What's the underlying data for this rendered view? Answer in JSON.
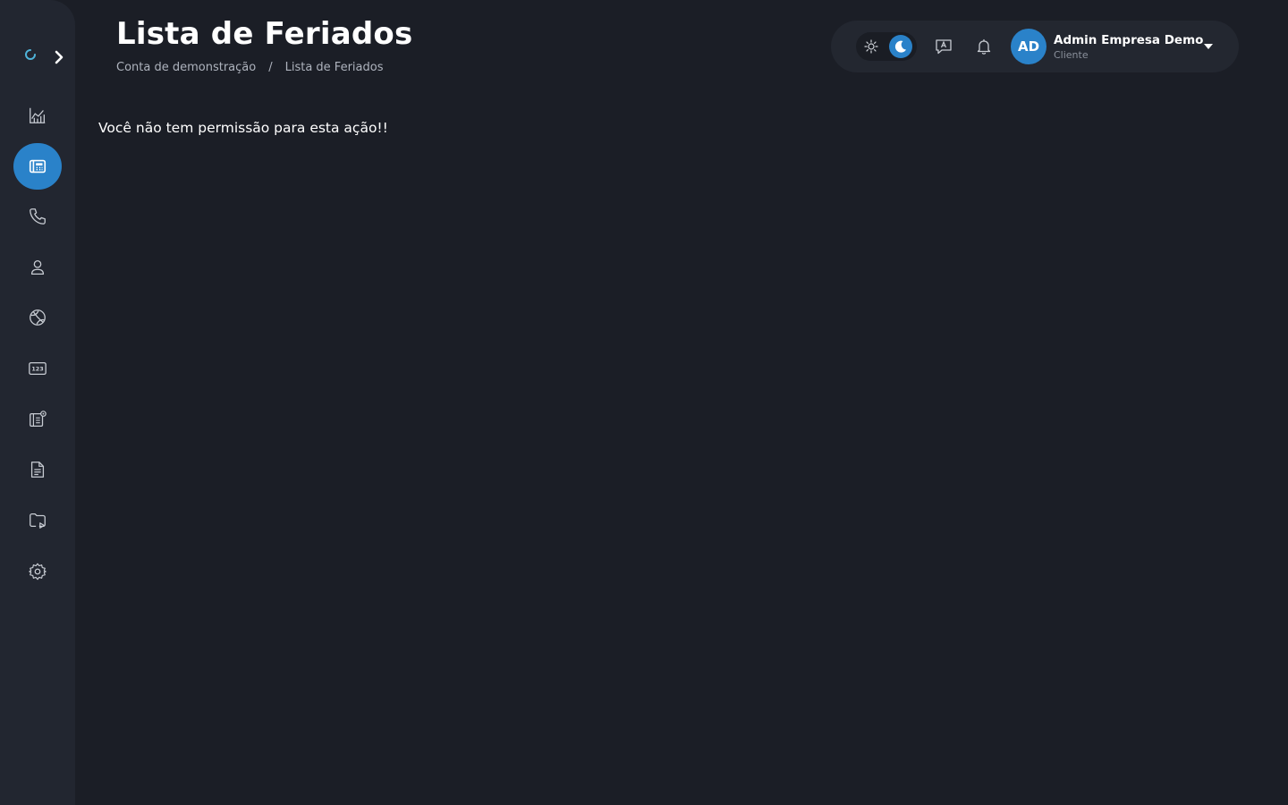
{
  "page": {
    "title": "Lista de Feriados",
    "breadcrumb": [
      "Conta de demonstração",
      "/",
      "Lista de Feriados"
    ],
    "message": "Você não tem permissão para esta ação!!"
  },
  "sidebar": {
    "items": [
      {
        "icon": "chart-icon",
        "active": false
      },
      {
        "icon": "phone-list-icon",
        "active": true
      },
      {
        "icon": "phone-icon",
        "active": false
      },
      {
        "icon": "user-icon",
        "active": false
      },
      {
        "icon": "globe-icon",
        "active": false
      },
      {
        "icon": "numbers-123-icon",
        "active": false
      },
      {
        "icon": "contact-settings-icon",
        "active": false
      },
      {
        "icon": "document-icon",
        "active": false
      },
      {
        "icon": "folder-play-icon",
        "active": false
      },
      {
        "icon": "gear-icon",
        "active": false
      }
    ]
  },
  "topbar": {
    "avatar_initials": "AD",
    "user_name": "Admin Empresa Demo",
    "user_role": "Cliente",
    "theme": "dark"
  },
  "colors": {
    "background": "#1b1e26",
    "sidebar": "#222630",
    "accent": "#2a82c9",
    "muted_text": "#aeb3bd"
  }
}
